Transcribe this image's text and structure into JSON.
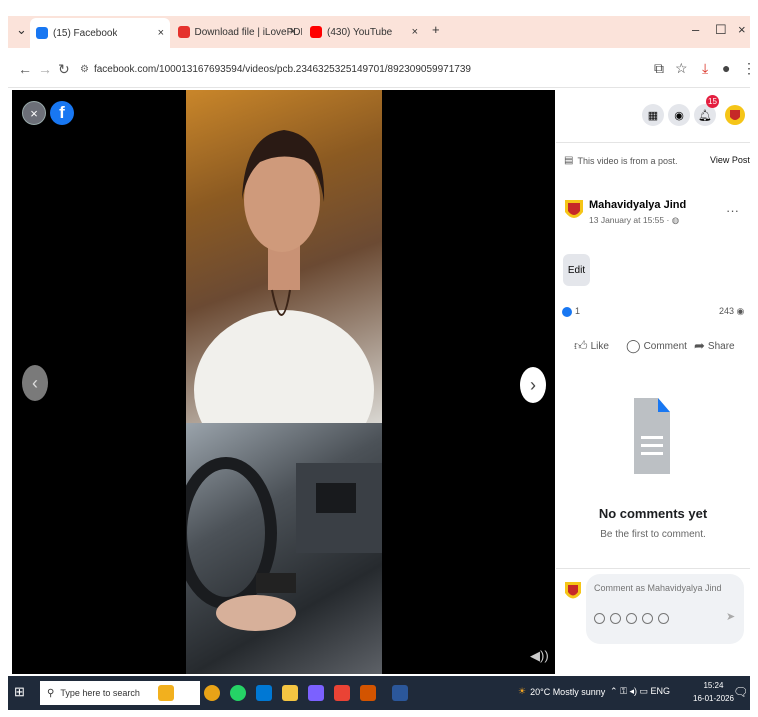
{
  "browser": {
    "tabs": [
      {
        "label": "(15) Facebook",
        "color": "#1877f2",
        "active": true
      },
      {
        "label": "Download file | iLovePDF",
        "color": "#e5322d",
        "active": false
      },
      {
        "label": "(430) YouTube",
        "color": "#ff0000",
        "active": false
      }
    ],
    "new_tab_label": "+",
    "url": "facebook.com/100013167693594/videos/pcb.2346325325149701/892309059971739"
  },
  "video_viewer": {
    "close_icon_glyph": "×",
    "fb_logo_glyph": "f",
    "prev_glyph": "‹",
    "next_glyph": "›"
  },
  "panel": {
    "notification_count": "15",
    "post_note": "This video is from a post.",
    "view_post_label": "View Post",
    "page_name": "Mahavidyalya Jind",
    "post_time": "13 January at 15:55 · ",
    "edit_label": "Edit",
    "reaction_count": "1",
    "views_count": "243",
    "actions": {
      "like": "Like",
      "comment": "Comment",
      "share": "Share"
    },
    "no_comments_title": "No comments yet",
    "no_comments_sub": "Be the first to comment.",
    "comment_placeholder": "Comment as Mahavidyalya Jind"
  },
  "taskbar": {
    "search_placeholder": "Type here to search",
    "weather": "20°C  Mostly sunny",
    "language": "ENG",
    "time": "15:24",
    "date": "16-01-2026"
  },
  "colors": {
    "facebook_blue": "#1877f2",
    "tab_bar": "#fbe3da",
    "taskbar": "#1f2a3a",
    "badge_red": "#e41e3f"
  }
}
